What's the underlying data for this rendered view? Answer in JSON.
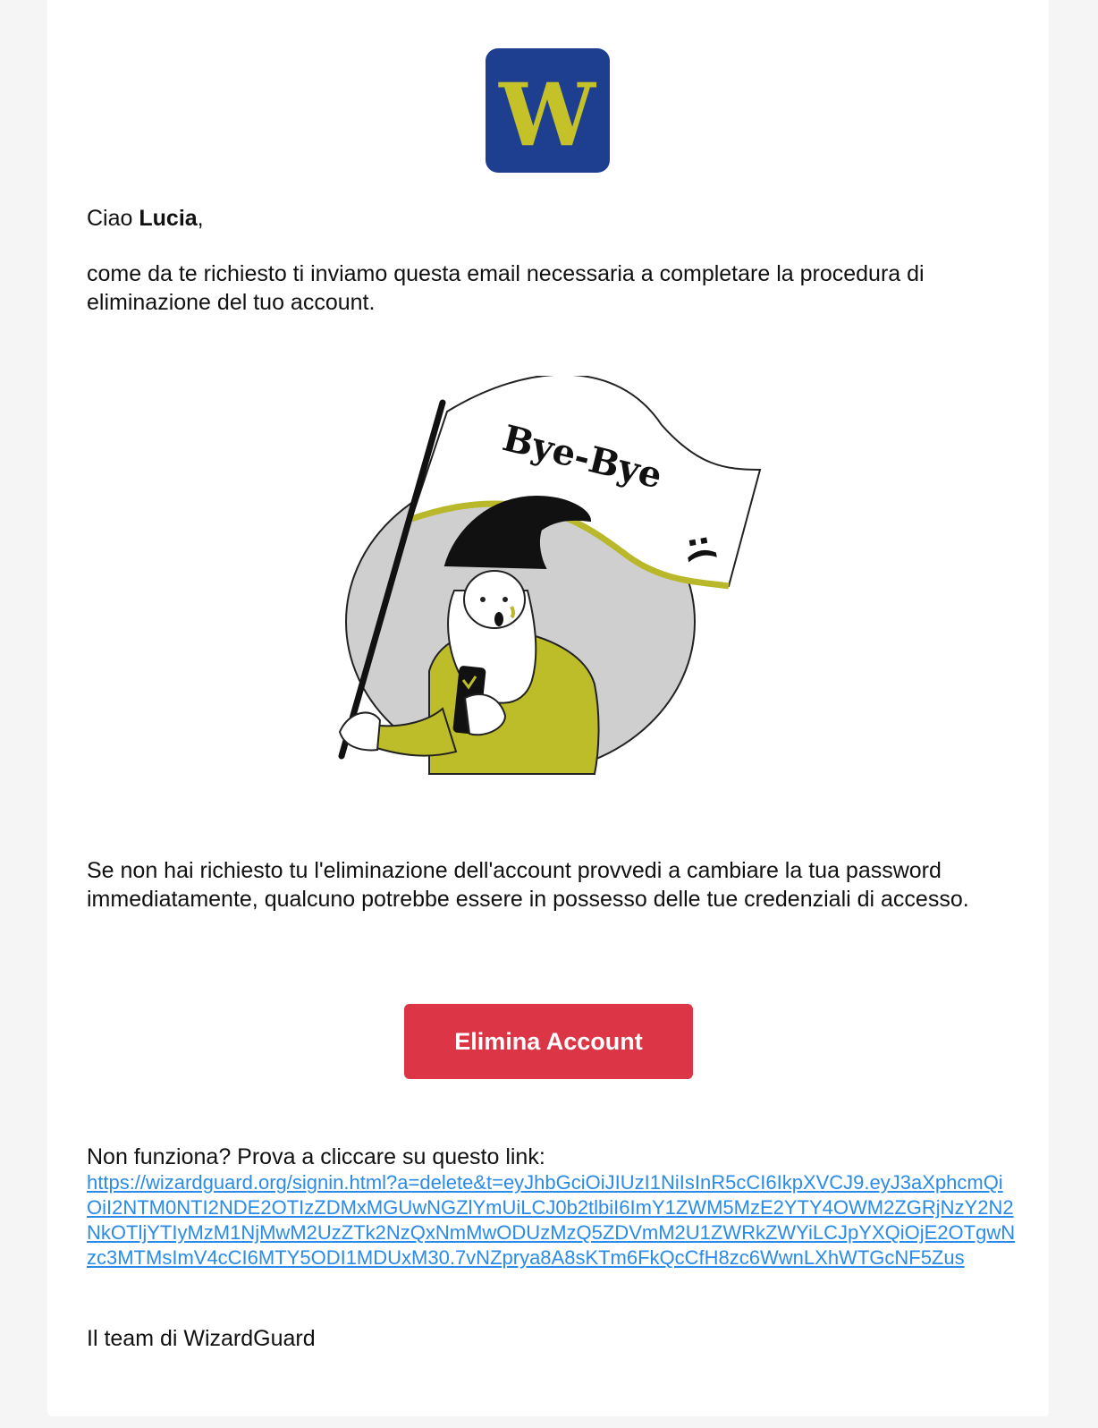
{
  "logo": {
    "letter": "W",
    "bg": "#1e3f8f",
    "fg": "#c5c128"
  },
  "greeting": {
    "prefix": "Ciao ",
    "name": "Lucia",
    "suffix": ","
  },
  "intro": "come da te richiesto ti inviamo questa email necessaria a completare la procedura di eliminazione del tuo account.",
  "illustration": {
    "flag_text": "Bye-Bye",
    "flag_emoticon": ":("
  },
  "warning": "Se non hai richiesto tu l'eliminazione dell'account provvedi a cambiare la tua password immediatamente, qualcuno potrebbe essere in possesso delle tue credenziali di accesso.",
  "cta": {
    "label": "Elimina Account",
    "color": "#dc3545"
  },
  "fallback": {
    "prompt": "Non funziona? Prova a cliccare su questo link:",
    "url": "https://wizardguard.org/signin.html?a=delete&t=eyJhbGciOiJIUzI1NiIsInR5cCI6IkpXVCJ9.eyJ3aXphcmQiOiI2NTM0NTI2NDE2OTIzZDMxMGUwNGZlYmUiLCJ0b2tlbiI6ImY1ZWM5MzE2YTY4OWM2ZGRjNzY2N2NkOTljYTIyMzM1NjMwM2UzZTk2NzQxNmMwODUzMzQ5ZDVmM2U1ZWRkZWYiLCJpYXQiOjE2OTgwNzc3MTMsImV4cCI6MTY5ODI1MDUxM30.7vNZprya8A8sKTm6FkQcCfH8zc6WwnLXhWTGcNF5Zus",
    "link_color": "#2a8be8"
  },
  "signature": "Il team di WizardGuard"
}
